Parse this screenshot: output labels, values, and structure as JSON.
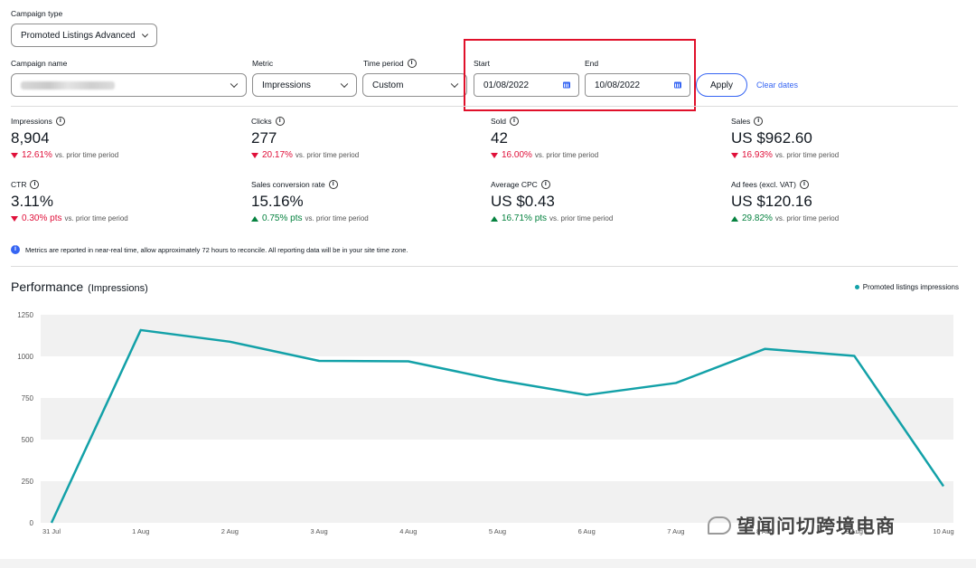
{
  "filters": {
    "campaign_type_label": "Campaign type",
    "campaign_type_value": "Promoted Listings Advanced",
    "campaign_name_label": "Campaign name",
    "metric_label": "Metric",
    "metric_value": "Impressions",
    "time_period_label": "Time period",
    "time_period_value": "Custom",
    "start_label": "Start",
    "start_value": "01/08/2022",
    "end_label": "End",
    "end_value": "10/08/2022",
    "apply_label": "Apply",
    "clear_label": "Clear dates"
  },
  "metrics": [
    {
      "label": "Impressions",
      "value": "8,904",
      "delta": "12.61%",
      "dir": "down",
      "note": "vs. prior time period"
    },
    {
      "label": "Clicks",
      "value": "277",
      "delta": "20.17%",
      "dir": "down",
      "note": "vs. prior time period"
    },
    {
      "label": "Sold",
      "value": "42",
      "delta": "16.00%",
      "dir": "down",
      "note": "vs. prior time period"
    },
    {
      "label": "Sales",
      "value": "US $962.60",
      "delta": "16.93%",
      "dir": "down",
      "note": "vs. prior time period"
    },
    {
      "label": "CTR",
      "value": "3.11%",
      "delta": "0.30% pts",
      "dir": "down",
      "note": "vs. prior time period"
    },
    {
      "label": "Sales conversion rate",
      "value": "15.16%",
      "delta": "0.75% pts",
      "dir": "up",
      "note": "vs. prior time period"
    },
    {
      "label": "Average CPC",
      "value": "US $0.43",
      "delta": "16.71% pts",
      "dir": "up",
      "note": "vs. prior time period"
    },
    {
      "label": "Ad fees (excl. VAT)",
      "value": "US $120.16",
      "delta": "29.82%",
      "dir": "up",
      "note": "vs. prior time period"
    }
  ],
  "notice": "Metrics are reported in near-real time, allow approximately 72 hours to reconcile. All reporting data will be in your site time zone.",
  "performance": {
    "title": "Performance",
    "subtitle": "(Impressions)",
    "legend": "Promoted listings impressions"
  },
  "watermark": "望闻问切跨境电商",
  "colors": {
    "accent": "#3665f3",
    "line": "#13a1a8",
    "down": "#e0103a",
    "up": "#05823f",
    "highlight": "#e0102a"
  },
  "chart_data": {
    "type": "line",
    "x": [
      "31 Jul",
      "1 Aug",
      "2 Aug",
      "3 Aug",
      "4 Aug",
      "5 Aug",
      "6 Aug",
      "7 Aug",
      "8 Aug",
      "9 Aug",
      "10 Aug"
    ],
    "series": [
      {
        "name": "Promoted listings impressions",
        "values": [
          0,
          1158,
          1088,
          973,
          970,
          858,
          768,
          840,
          1045,
          1003,
          220
        ]
      }
    ],
    "yticks": [
      0,
      250,
      500,
      750,
      1000,
      1250
    ],
    "ylim": [
      0,
      1250
    ],
    "legend_position": "top-right"
  }
}
